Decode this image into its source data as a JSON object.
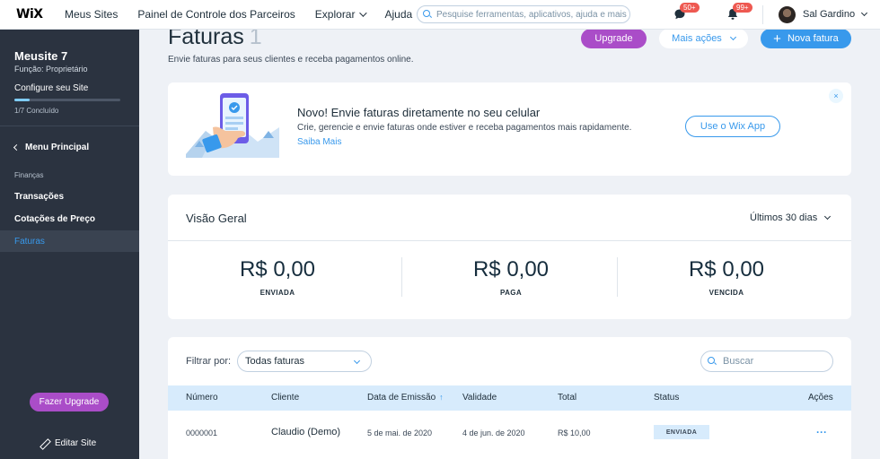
{
  "topbar": {
    "logo": "WiX",
    "nav": [
      {
        "label": "Meus Sites",
        "has_chevron": false
      },
      {
        "label": "Painel de Controle dos Parceiros",
        "has_chevron": false
      },
      {
        "label": "Explorar",
        "has_chevron": true
      },
      {
        "label": "Ajuda",
        "has_chevron": true
      }
    ],
    "search_placeholder": "Pesquise ferramentas, aplicativos, ajuda e mais",
    "inbox_badge": "50+",
    "notifications_badge": "99+",
    "user_name": "Sal Gardino"
  },
  "sidebar": {
    "site_name": "Meusite 7",
    "role": "Função: Proprietário",
    "config_label": "Configure seu Site",
    "progress_fraction": 0.14,
    "completed_label": "1/7 Concluído",
    "back_label": "Menu Principal",
    "section_label": "Finanças",
    "items": [
      {
        "label": "Transações",
        "active": false
      },
      {
        "label": "Cotações de Preço",
        "active": false
      },
      {
        "label": "Faturas",
        "active": true
      }
    ],
    "upgrade_label": "Fazer Upgrade",
    "edit_label": "Editar Site"
  },
  "header": {
    "title": "Faturas",
    "count": "1",
    "subtitle": "Envie faturas para seus clientes e receba pagamentos online.",
    "upgrade_label": "Upgrade",
    "more_actions_label": "Mais ações",
    "new_invoice_label": "Nova fatura"
  },
  "promo": {
    "title": "Novo! Envie faturas diretamente no seu celular",
    "description": "Crie, gerencie e envie faturas onde estiver e receba pagamentos mais rapidamente.",
    "link": "Saiba Mais",
    "button": "Use o Wix App",
    "close": "×"
  },
  "overview": {
    "title": "Visão Geral",
    "period": "Últimos 30 dias",
    "stats": [
      {
        "value": "R$ 0,00",
        "label": "ENVIADA"
      },
      {
        "value": "R$ 0,00",
        "label": "PAGA"
      },
      {
        "value": "R$ 0,00",
        "label": "VENCIDA"
      }
    ]
  },
  "table": {
    "filter_label": "Filtrar por:",
    "filter_value": "Todas faturas",
    "search_placeholder": "Buscar",
    "columns": [
      "Número",
      "Cliente",
      "Data de Emissão",
      "Validade",
      "Total",
      "Status",
      "Ações"
    ],
    "sort_indicator": "↑",
    "rows": [
      {
        "number": "0000001",
        "client": "Claudio (Demo)",
        "issue_date": "5 de mai. de 2020",
        "due_date": "4 de jun. de 2020",
        "total": "R$ 10,00",
        "status": "ENVIADA",
        "actions": "···"
      }
    ]
  }
}
